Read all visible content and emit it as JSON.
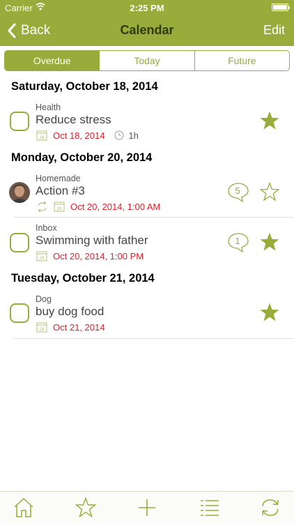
{
  "status_bar": {
    "carrier": "Carrier",
    "time": "2:25 PM"
  },
  "nav": {
    "back_label": "Back",
    "title": "Calendar",
    "edit_label": "Edit"
  },
  "segments": [
    {
      "label": "Overdue",
      "active": true
    },
    {
      "label": "Today",
      "active": false
    },
    {
      "label": "Future",
      "active": false
    }
  ],
  "sections": [
    {
      "heading": "Saturday, October 18, 2014",
      "tasks": [
        {
          "project": "Health",
          "title": "Reduce stress",
          "date": "Oct 18, 2014",
          "duration": "1h",
          "starred": true
        }
      ]
    },
    {
      "heading": "Monday, October 20, 2014",
      "tasks": [
        {
          "project": "Homemade",
          "title": "Action #3",
          "date": "Oct 20, 2014, 1:00 AM",
          "comments": "5",
          "starred": false,
          "repeat": true,
          "avatar": true
        },
        {
          "project": "Inbox",
          "title": "Swimming with father",
          "date": "Oct 20, 2014, 1:00 PM",
          "comments": "1",
          "starred": true
        }
      ]
    },
    {
      "heading": "Tuesday, October 21, 2014",
      "tasks": [
        {
          "project": "Dog",
          "title": "buy dog food",
          "date": "Oct 21, 2014",
          "starred": true
        }
      ]
    }
  ],
  "calendar_icon_day": "28",
  "tabbar": {
    "items": [
      "home-icon",
      "star-icon",
      "plus-icon",
      "list-icon",
      "sync-icon"
    ]
  },
  "colors": {
    "accent": "#98ab3b",
    "due_date": "#e0202a",
    "title_dark": "#2f3b10"
  }
}
